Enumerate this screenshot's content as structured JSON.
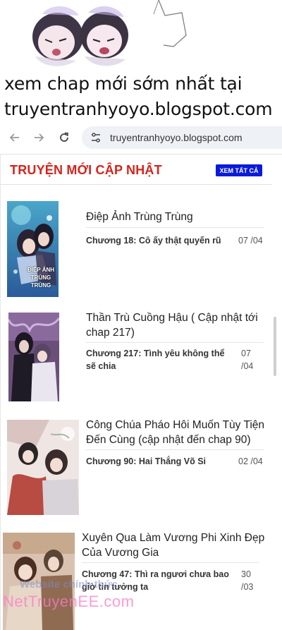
{
  "promo": {
    "line1": "xem chap mới sớm nhất tại",
    "line2": "truyentranhyoyo.blogspot.com"
  },
  "browser": {
    "url": "truyentranhyoyo.blogspot.com",
    "back_icon": "back-arrow-icon",
    "forward_icon": "forward-arrow-icon",
    "reload_icon": "reload-icon",
    "site_settings_icon": "tune-icon"
  },
  "section": {
    "title": "TRUYỆN MỚI CẬP NHẬT",
    "see_all": "XEM TẤT CẢ",
    "title_color": "#d6231b",
    "button_color": "#0a1bd9"
  },
  "items": [
    {
      "title": "Điệp Ảnh Trùng Trùng",
      "chapter": "Chương 18: Cô ấy thật quyến rũ",
      "date": "07 /04",
      "cover_text": "ĐIỆP ẢNH TRÙNG TRÙNG"
    },
    {
      "title": "Thần Trù Cuồng Hậu ( Cập nhật tới chap 217)",
      "chapter": "Chương 217: Tình yêu không thể sẽ chia",
      "date": "07 /04"
    },
    {
      "title": "Công Chúa Pháo Hôi Muốn Tùy Tiện Đến Cùng (cập nhật đến chap 90)",
      "chapter": "Chương 90: Hai Thắng Võ Si",
      "date": "02 /04"
    },
    {
      "title": "Xuyên Qua Làm Vương Phi Xinh Đẹp Của Vương Gia",
      "chapter": "Chương 47: Thì ra ngươi chưa bao giờ tin tưởng ta",
      "date": "30 /03"
    }
  ],
  "watermark": {
    "line1": "Website chính thức",
    "line2": "NetTruyenEE.com"
  }
}
